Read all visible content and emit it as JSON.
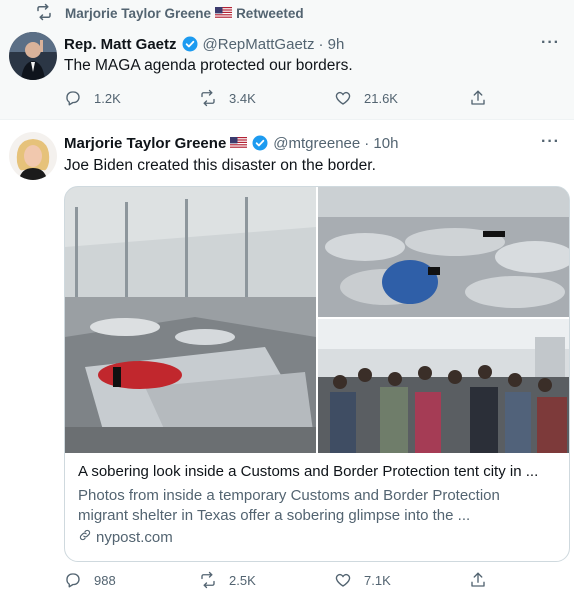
{
  "retweet_bar": {
    "retweeter": "Marjorie Taylor Greene",
    "flag_icon": "us-flag-icon",
    "label": "Retweeted"
  },
  "tweet1": {
    "name": "Rep. Matt Gaetz",
    "handle": "@RepMattGaetz",
    "time": "· 9h",
    "more": "···",
    "text": "The MAGA agenda protected our borders.",
    "replies": "1.2K",
    "retweets": "3.4K",
    "likes": "21.6K"
  },
  "tweet2": {
    "name": "Marjorie Taylor Greene",
    "handle": "@mtgreenee",
    "time": "· 10h",
    "more": "···",
    "text": "Joe Biden created this disaster on the border.",
    "card": {
      "title": "A sobering look inside a Customs and Border Protection tent city in ...",
      "description_line1": "Photos from inside a temporary Customs and Border Protection",
      "description_line2": "migrant shelter in Texas offer a sobering glimpse into the ...",
      "domain": "nypost.com"
    },
    "replies": "988",
    "retweets": "2.5K",
    "likes": "7.1K"
  },
  "colors": {
    "secondary_text": "#536471",
    "verified_blue": "#1d9bf0",
    "border": "#cfd9de",
    "retweet_bg": "#f7f9f9"
  }
}
